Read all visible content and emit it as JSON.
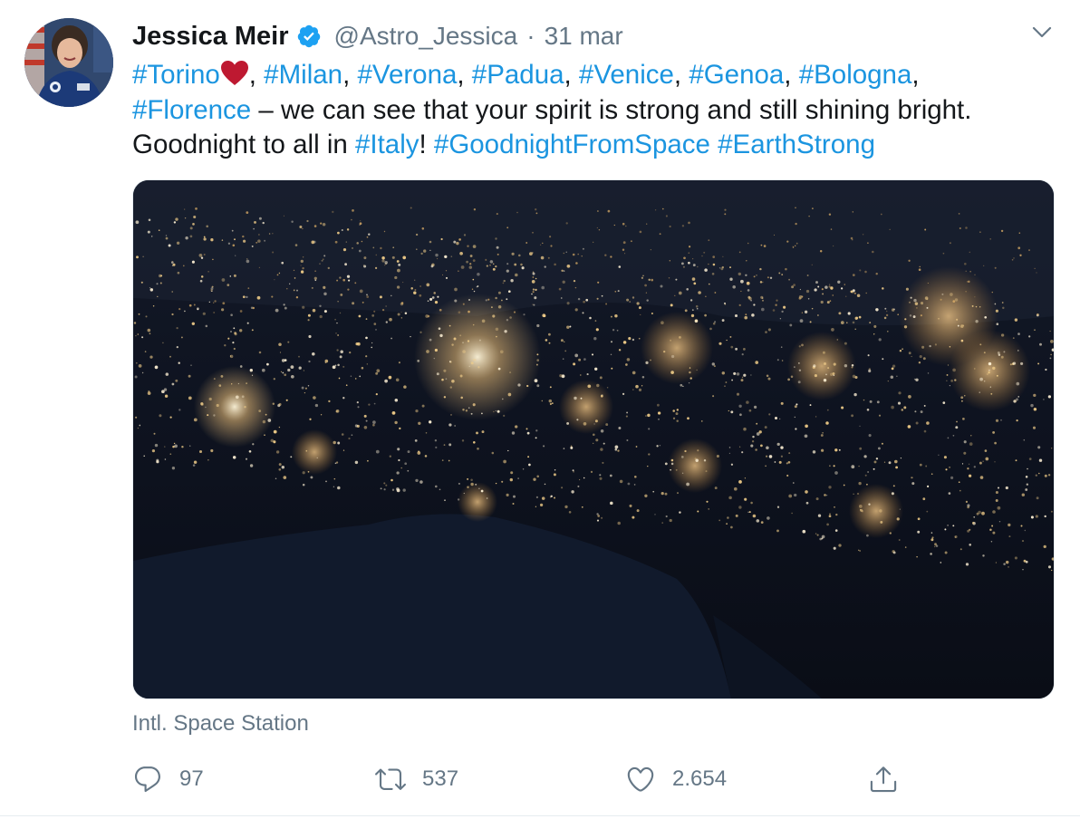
{
  "author": {
    "name": "Jessica Meir",
    "handle": "@Astro_Jessica",
    "separator": "·",
    "date": "31 mar"
  },
  "tweet": {
    "parts": [
      {
        "type": "tag",
        "text": "#Torino"
      },
      {
        "type": "emoji",
        "text": "❤️"
      },
      {
        "type": "text",
        "text": ", "
      },
      {
        "type": "tag",
        "text": "#Milan"
      },
      {
        "type": "text",
        "text": ", "
      },
      {
        "type": "tag",
        "text": "#Verona"
      },
      {
        "type": "text",
        "text": ", "
      },
      {
        "type": "tag",
        "text": "#Padua"
      },
      {
        "type": "text",
        "text": ", "
      },
      {
        "type": "tag",
        "text": "#Venice"
      },
      {
        "type": "text",
        "text": ", "
      },
      {
        "type": "tag",
        "text": "#Genoa"
      },
      {
        "type": "text",
        "text": ", "
      },
      {
        "type": "tag",
        "text": "#Bologna"
      },
      {
        "type": "text",
        "text": ","
      },
      {
        "type": "tag",
        "text": "#Florence"
      },
      {
        "type": "text",
        "text": " – we can see that your spirit is strong and still shining bright."
      },
      {
        "type": "text",
        "text": "Goodnight to all in "
      },
      {
        "type": "tag",
        "text": "#Italy"
      },
      {
        "type": "text",
        "text": "! "
      },
      {
        "type": "tag",
        "text": "#GoodnightFromSpace"
      },
      {
        "type": "text",
        "text": " "
      },
      {
        "type": "tag",
        "text": "#EarthStrong"
      }
    ]
  },
  "media": {
    "alt": "Night view of northern Italy from space"
  },
  "location": "Intl. Space Station",
  "actions": {
    "reply_count": "97",
    "retweet_count": "537",
    "like_count": "2.654"
  },
  "icons": {
    "verified": "verified-badge-icon",
    "menu": "chevron-down-icon",
    "reply": "reply-icon",
    "retweet": "retweet-icon",
    "like": "heart-icon",
    "share": "share-icon"
  },
  "colors": {
    "link": "#1b95e0",
    "secondary_text": "#657786",
    "verified": "#1da1f2",
    "heart_emoji": "#be1931"
  }
}
